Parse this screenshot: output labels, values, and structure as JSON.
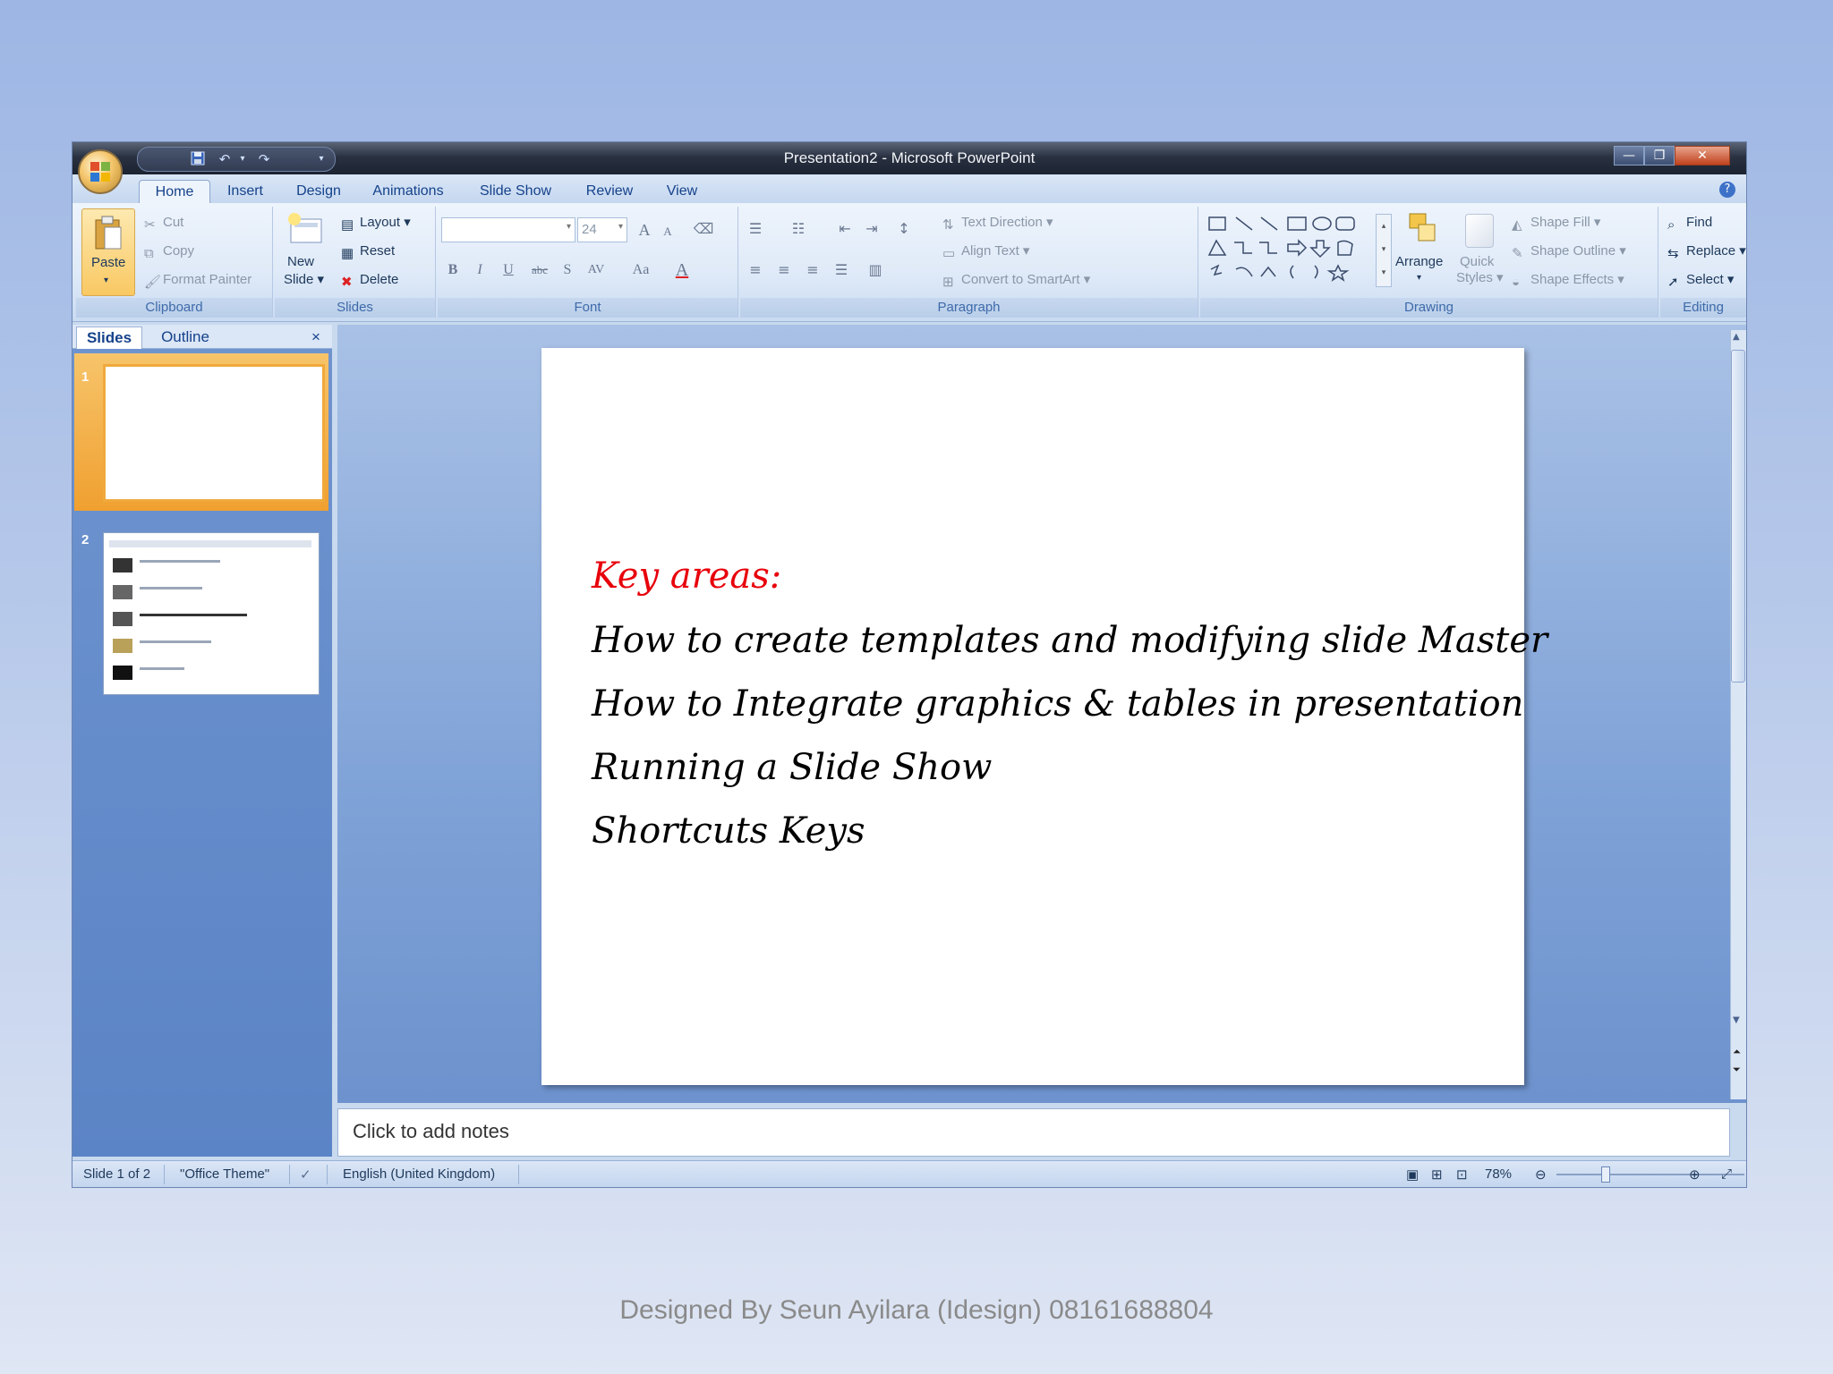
{
  "window": {
    "title": "Presentation2 - Microsoft PowerPoint",
    "controls": {
      "minimize": "—",
      "maximize": "❐",
      "close": "✕"
    }
  },
  "quick_access": [
    "save-icon",
    "undo-icon",
    "redo-icon",
    "customize-icon"
  ],
  "tabs": [
    "Home",
    "Insert",
    "Design",
    "Animations",
    "Slide Show",
    "Review",
    "View"
  ],
  "active_tab": "Home",
  "ribbon": {
    "clipboard": {
      "label": "Clipboard",
      "paste": "Paste",
      "cut": "Cut",
      "copy": "Copy",
      "format_painter": "Format Painter"
    },
    "slides": {
      "label": "Slides",
      "new_slide_1": "New",
      "new_slide_2": "Slide",
      "layout": "Layout",
      "reset": "Reset",
      "delete": "Delete"
    },
    "font": {
      "label": "Font",
      "font_size": "24",
      "bold": "B",
      "italic": "I",
      "underline": "U",
      "strike": "abc",
      "shadow": "S",
      "spacing": "AV",
      "case": "Aa",
      "color": "A",
      "grow": "A",
      "shrink": "A"
    },
    "paragraph": {
      "label": "Paragraph",
      "text_direction": "Text Direction",
      "align_text": "Align Text",
      "convert_smartart": "Convert to SmartArt"
    },
    "drawing": {
      "label": "Drawing",
      "arrange": "Arrange",
      "quick_styles_1": "Quick",
      "quick_styles_2": "Styles",
      "shape_fill": "Shape Fill",
      "shape_outline": "Shape Outline",
      "shape_effects": "Shape Effects"
    },
    "editing": {
      "label": "Editing",
      "find": "Find",
      "replace": "Replace",
      "select": "Select"
    }
  },
  "left_pane": {
    "tab_slides": "Slides",
    "tab_outline": "Outline",
    "close": "×",
    "thumb_numbers": [
      "1",
      "2"
    ]
  },
  "slide": {
    "heading": "Key areas:",
    "lines": [
      "How to create templates and modifying slide Master",
      "How to Integrate graphics & tables in presentation",
      "Running a Slide Show",
      "Shortcuts Keys"
    ]
  },
  "notes": {
    "placeholder": "Click to add notes"
  },
  "status": {
    "slide_info": "Slide 1 of 2",
    "theme": "\"Office Theme\"",
    "language": "English (United Kingdom)",
    "zoom": "78%"
  },
  "footer": "Designed By Seun Ayilara (Idesign)  08161688804",
  "colors": {
    "heading": "#e8000b",
    "accent": "#15428b",
    "selected_thumb": "#f0a93c"
  }
}
